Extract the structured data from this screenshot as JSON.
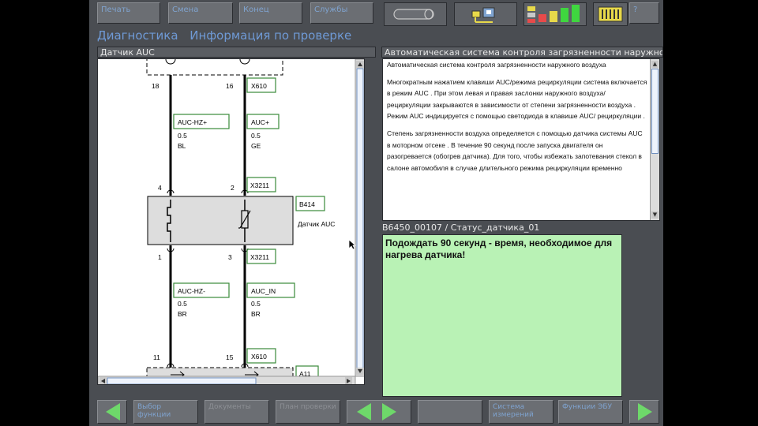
{
  "toolbar": {
    "print_label": "Печать",
    "change_label": "Смена",
    "end_label": "Конец",
    "services_label": "Службы",
    "help_label": "?"
  },
  "header": {
    "section": "Диагностика",
    "title": "Информация по проверке"
  },
  "diagram_panel": {
    "title": "Датчик AUC",
    "pins": [
      "18",
      "16",
      "4",
      "2",
      "1",
      "3",
      "11",
      "15"
    ],
    "connectors": [
      "X610",
      "X3211",
      "X3211",
      "X610"
    ],
    "wires": [
      {
        "name": "AUC-HZ+",
        "size": "0.5",
        "color": "BL"
      },
      {
        "name": "AUC+",
        "size": "0.5",
        "color": "GE"
      },
      {
        "name": "AUC-HZ-",
        "size": "0.5",
        "color": "BR"
      },
      {
        "name": "AUC_IN",
        "size": "0.5",
        "color": "BR"
      }
    ],
    "component_id": "B414",
    "component_name": "Датчик AUC",
    "module_id": "A11"
  },
  "info_panel": {
    "title": "Автоматическая система контроля загрязненности наружного воздуха",
    "paragraphs": [
      "Автоматическая система контроля загрязненности наружного воздуха",
      "Многократным нажатием клавиши AUC/режима рециркуляции система включается в режим AUC . При этом левая и правая заслонки наружного воздуха/рециркуляции закрываются в зависимости от степени загрязненности воздуха . Режим AUC индицируется с помощью светодиода  в клавише AUC/ рециркуляции .",
      "Степень загрязненности воздуха определяется с помощью датчика системы AUC  в моторном отсеке . В течение 90 секунд  после запуска двигателя  он разогревается (обогрев датчика). Для того, чтобы избежать  запотевания стекол  в салоне автомобиля в случае длительного режима рециркуляции  временно"
    ]
  },
  "status": {
    "label": "B6450_00107 / Статус_датчика_01",
    "message": "Подождать 90 секунд - время, необходимое для нагрева датчика!"
  },
  "bottom_bar": {
    "select_function_label": "Выбор функции",
    "documents_label": "Документы",
    "test_plan_label": "План проверки",
    "empty_label": "",
    "measurement_system_label": "Система измерений",
    "ecu_functions_label": "Функции ЭБУ"
  },
  "colors": {
    "background": "#4a4d52",
    "accent_text": "#7fa3cf",
    "status_bg": "#b9f2b5",
    "arrow_green": "#6ed86a",
    "label_box_border": "#3a8a3a"
  }
}
